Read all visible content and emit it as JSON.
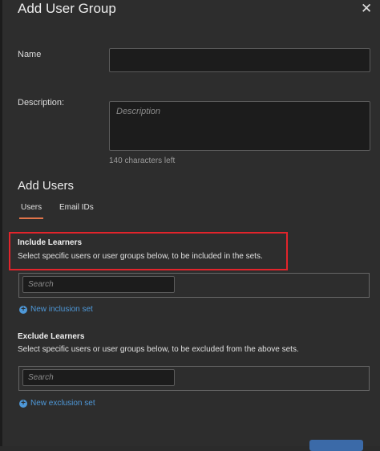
{
  "dialog": {
    "title": "Add User Group",
    "close_glyph": "✕"
  },
  "form": {
    "name_label": "Name",
    "name_value": "",
    "description_label": "Description:",
    "description_placeholder": "Description",
    "description_hint": "140 characters left"
  },
  "add_users": {
    "title": "Add Users",
    "tabs": [
      {
        "label": "Users",
        "active": true
      },
      {
        "label": "Email IDs",
        "active": false
      }
    ]
  },
  "include": {
    "title": "Include Learners",
    "description": "Select specific users or user groups below, to be included in the sets.",
    "search_placeholder": "Search",
    "add_link": "New inclusion set"
  },
  "exclude": {
    "title": "Exclude Learners",
    "description": "Select specific users or user groups below, to be excluded from the above sets.",
    "search_placeholder": "Search",
    "add_link": "New exclusion set"
  },
  "icons": {
    "close": "close-icon",
    "plus": "plus-circle-icon"
  },
  "colors": {
    "accent_tab": "#e1744a",
    "link": "#4e98d8",
    "highlight_box": "#e2242b"
  }
}
